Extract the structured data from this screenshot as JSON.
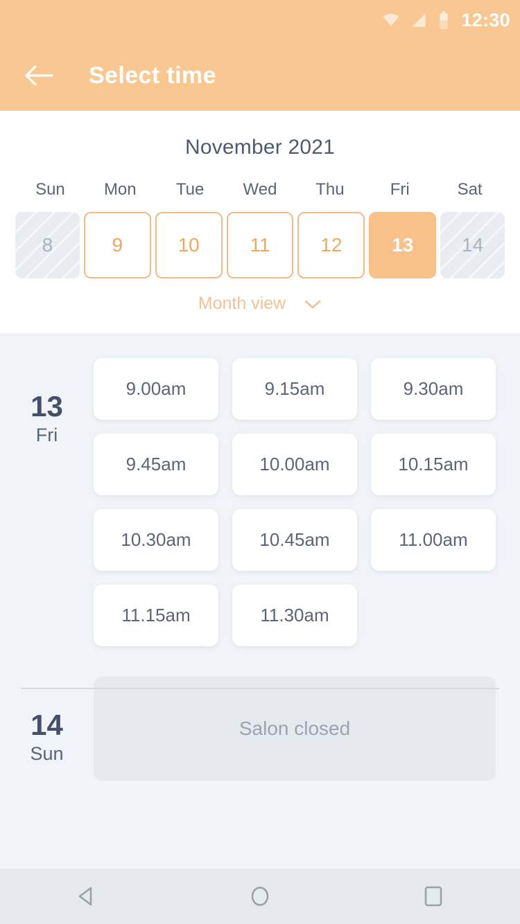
{
  "status_bar": {
    "clock": "12:30",
    "icons": [
      "wifi-icon",
      "signal-icon",
      "battery-icon"
    ]
  },
  "app_bar": {
    "back_icon": "back-arrow-icon",
    "title": "Select time"
  },
  "calendar": {
    "month_title": "November 2021",
    "weekdays": [
      "Sun",
      "Mon",
      "Tue",
      "Wed",
      "Thu",
      "Fri",
      "Sat"
    ],
    "dates": [
      {
        "day": "8",
        "state": "disabled"
      },
      {
        "day": "9",
        "state": "available"
      },
      {
        "day": "10",
        "state": "available"
      },
      {
        "day": "11",
        "state": "available"
      },
      {
        "day": "12",
        "state": "available"
      },
      {
        "day": "13",
        "state": "selected"
      },
      {
        "day": "14",
        "state": "disabled"
      }
    ],
    "month_view_label": "Month view",
    "month_view_icon": "chevron-down-icon"
  },
  "schedule": [
    {
      "day_number": "13",
      "day_name": "Fri",
      "slots": [
        "9.00am",
        "9.15am",
        "9.30am",
        "9.45am",
        "10.00am",
        "10.15am",
        "10.30am",
        "10.45am",
        "11.00am",
        "11.15am",
        "11.30am"
      ],
      "closed": false,
      "closed_label": ""
    },
    {
      "day_number": "14",
      "day_name": "Sun",
      "slots": [],
      "closed": true,
      "closed_label": "Salon closed"
    }
  ],
  "nav_bar": {
    "back": "nav-back-icon",
    "home": "nav-home-icon",
    "recents": "nav-recents-icon"
  },
  "colors": {
    "accent": "#F8C792",
    "accent_border": "#F0BA82",
    "accent_text": "#EFA95F",
    "selected_bg": "#F8C18A",
    "body_bg": "#F0F3F7",
    "slot_text": "#5B6577",
    "heading": "#44506A",
    "closed_bg": "#E6E9EE",
    "closed_text": "#9AA3B2"
  }
}
